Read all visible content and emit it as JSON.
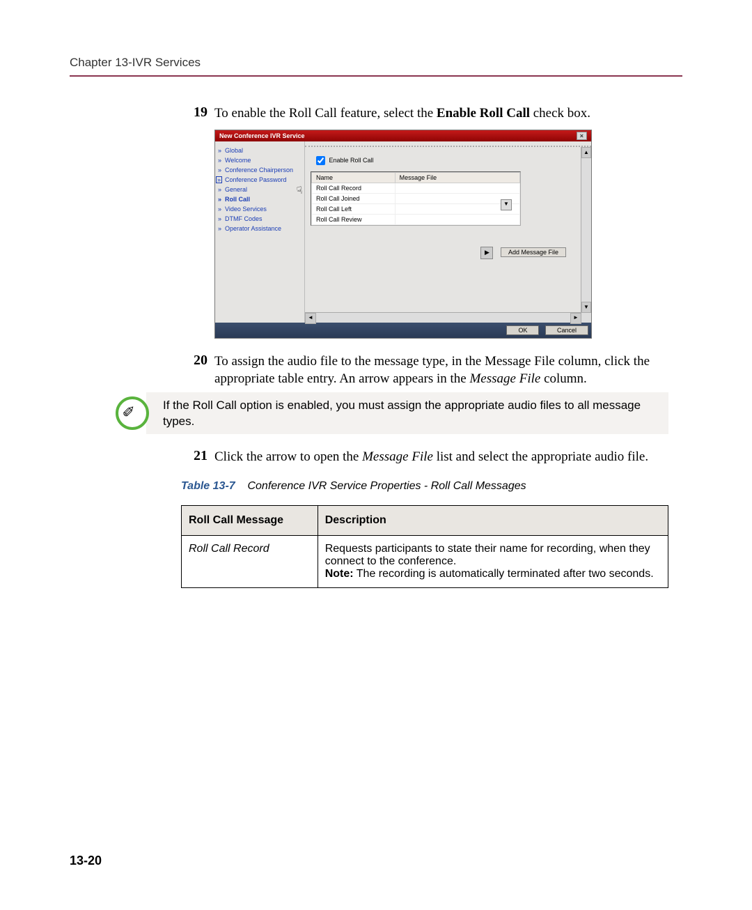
{
  "chapter_header": "Chapter 13-IVR Services",
  "step19": {
    "num": "19",
    "text_a": "To enable the Roll Call feature, select the ",
    "text_b": "Enable Roll Call",
    "text_c": " check box."
  },
  "dialog": {
    "title": "New Conference IVR Service",
    "sidebar": [
      "Global",
      "Welcome",
      "Conference Chairperson",
      "Conference Password",
      "General",
      "Roll Call",
      "Video Services",
      "DTMF Codes",
      "Operator Assistance"
    ],
    "enable_cb": "Enable Roll Call",
    "table_headers": {
      "name": "Name",
      "msg": "Message File"
    },
    "rows": [
      "Roll Call Record",
      "Roll Call Joined",
      "Roll Call Left",
      "Roll Call Review"
    ],
    "add_btn": "Add Message File",
    "ok": "OK",
    "cancel": "Cancel"
  },
  "step20": {
    "num": "20",
    "text_a": "To assign the audio file to the message type, in the Message File column, click the appropriate table entry. An arrow appears in the ",
    "text_b": "Message File",
    "text_c": " column."
  },
  "note": "If the Roll Call option is enabled, you must assign the appropriate audio files to all message types.",
  "step21": {
    "num": "21",
    "text_a": "Click the arrow to open the ",
    "text_b": "Message File",
    "text_c": " list and select the appropriate audio file."
  },
  "table_caption": {
    "label": "Table 13-7",
    "text": "Conference IVR Service Properties - Roll Call Messages"
  },
  "props_table": {
    "h1": "Roll Call Message",
    "h2": "Description",
    "row1_name": "Roll Call Record",
    "row1_desc_a": "Requests participants to state their name for recording, when they connect to the conference.",
    "row1_desc_note_label": "Note:",
    "row1_desc_note_text": " The recording is automatically terminated after two seconds."
  },
  "page_num": "13-20"
}
